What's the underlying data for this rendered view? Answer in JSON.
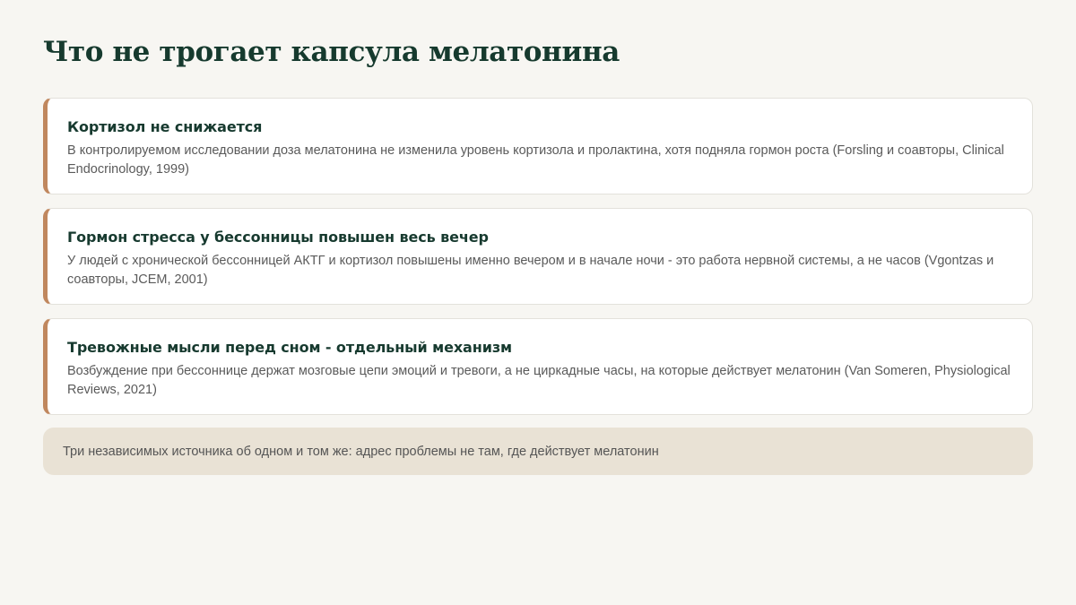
{
  "title": "Что не трогает капсула мелатонина",
  "cards": [
    {
      "title": "Кортизол не снижается",
      "text": "В контролируемом исследовании доза мелатонина не изменила уровень кортизола и пролактина, хотя подняла гормон роста (Forsling и соавторы, Clinical Endocrinology, 1999)"
    },
    {
      "title": "Гормон стресса у бессонницы повышен весь вечер",
      "text": "У людей с хронической бессонницей АКТГ и кортизол повышены именно вечером и в начале ночи - это работа нервной системы, а не часов (Vgontzas и соавторы, JCEM, 2001)"
    },
    {
      "title": "Тревожные мысли перед сном - отдельный механизм",
      "text": "Возбуждение при бессоннице держат мозговые цепи эмоций и тревоги, а не циркадные часы, на которые действует мелатонин (Van Someren, Physiological Reviews, 2021)"
    }
  ],
  "summary": "Три независимых источника об одном и том же: адрес проблемы не там, где действует мелатонин",
  "colors": {
    "background": "#f7f6f2",
    "title": "#163a2e",
    "accent_border": "#c0875e",
    "summary_background": "#e9e2d5"
  }
}
